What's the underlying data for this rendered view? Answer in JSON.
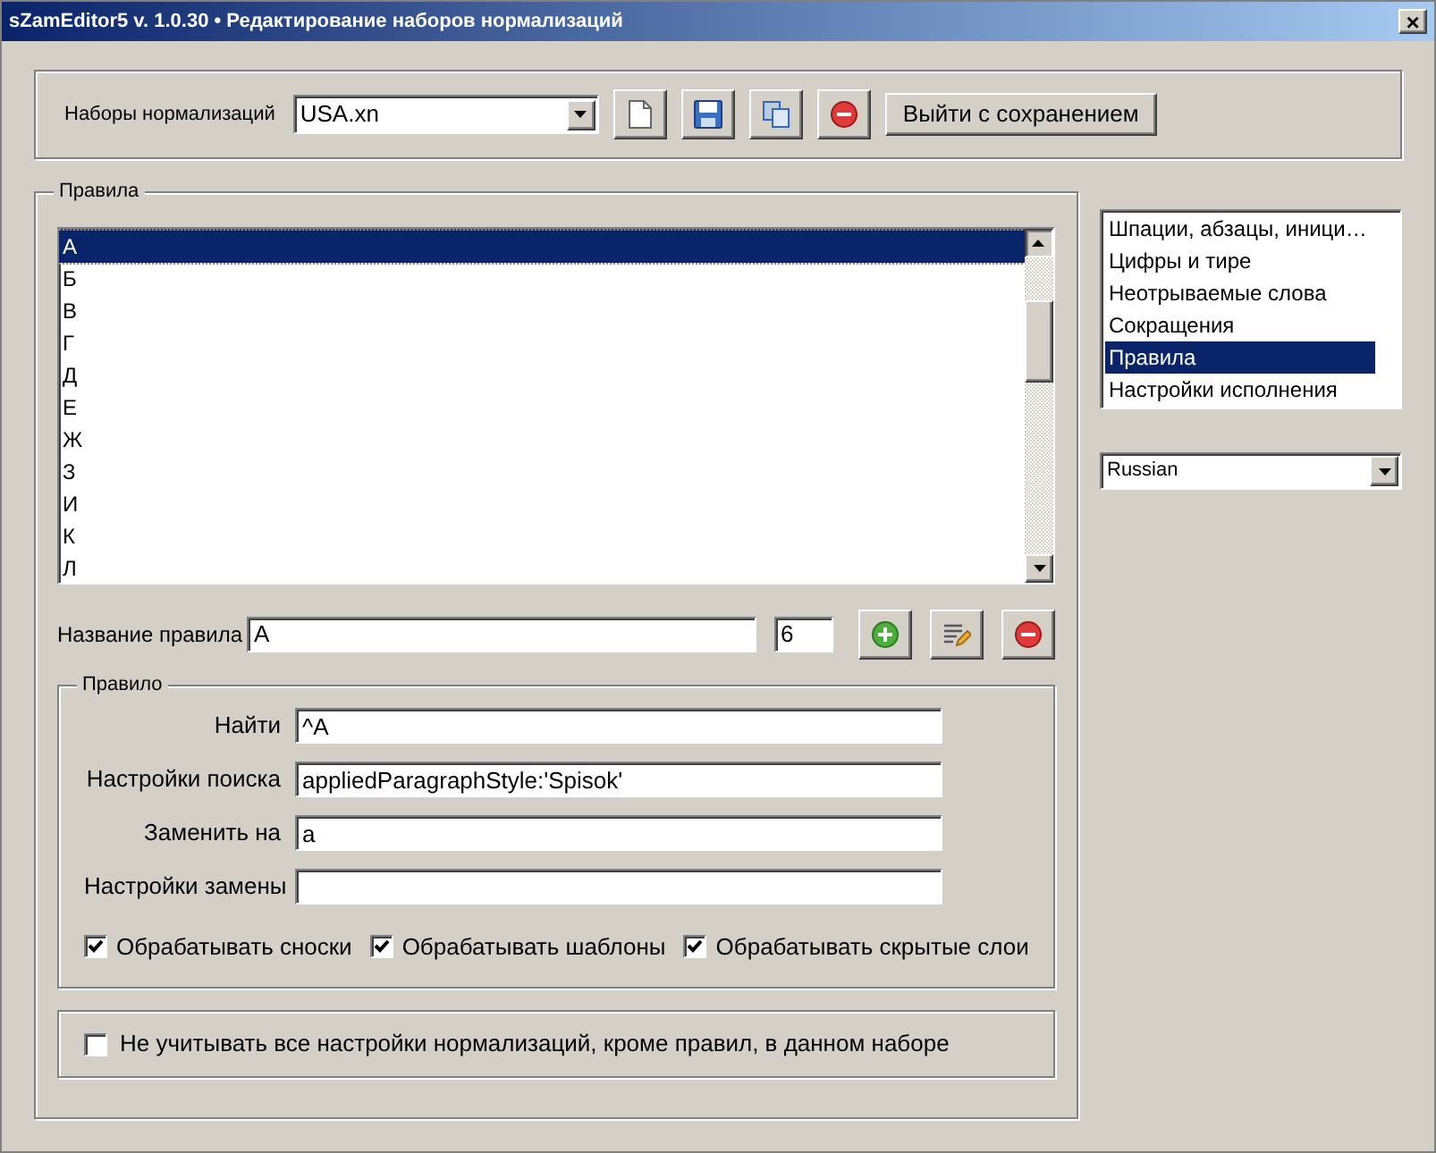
{
  "window": {
    "title": "sZamEditor5 v. 1.0.30 • Редактирование наборов нормализаций",
    "close": "×"
  },
  "sets": {
    "label": "Наборы нормализаций",
    "value": "USA.xn",
    "exit_button": "Выйти с сохранением"
  },
  "rules_group": {
    "title": "Правила",
    "items": [
      {
        "label": "А",
        "selected": true
      },
      {
        "label": "Б",
        "selected": false
      },
      {
        "label": "В",
        "selected": false
      },
      {
        "label": "Г",
        "selected": false
      },
      {
        "label": "Д",
        "selected": false
      },
      {
        "label": "Е",
        "selected": false
      },
      {
        "label": "Ж",
        "selected": false
      },
      {
        "label": "З",
        "selected": false
      },
      {
        "label": "И",
        "selected": false
      },
      {
        "label": "К",
        "selected": false
      },
      {
        "label": "Л",
        "selected": false
      }
    ],
    "name_label": "Название правила",
    "name_value": "А",
    "number": "6"
  },
  "rule": {
    "title": "Правило",
    "fields": [
      {
        "label": "Найти",
        "value": "^A"
      },
      {
        "label": "Настройки поиска",
        "value": "appliedParagraphStyle:'Spisok'"
      },
      {
        "label": "Заменить на",
        "value": "a"
      },
      {
        "label": "Настройки замены"
      }
    ],
    "options": [
      {
        "label": "Обрабатывать сноски",
        "checked": true
      },
      {
        "label": "Обрабатывать шаблоны",
        "checked": true
      },
      {
        "label": "Обрабатывать скрытые слои",
        "checked": true
      }
    ]
  },
  "ignore_option": {
    "label": "Не учитывать все настройки нормализаций, кроме правил, в данном наборе",
    "checked": false
  },
  "sections": [
    {
      "label": "Шпации, абзацы, иници…",
      "selected": false
    },
    {
      "label": "Цифры и тире",
      "selected": false
    },
    {
      "label": "Неотрываемые слова",
      "selected": false
    },
    {
      "label": "Сокращения",
      "selected": false
    },
    {
      "label": "Правила",
      "selected": true
    },
    {
      "label": "Настройки исполнения",
      "selected": false
    }
  ],
  "language": {
    "value": "Russian"
  }
}
